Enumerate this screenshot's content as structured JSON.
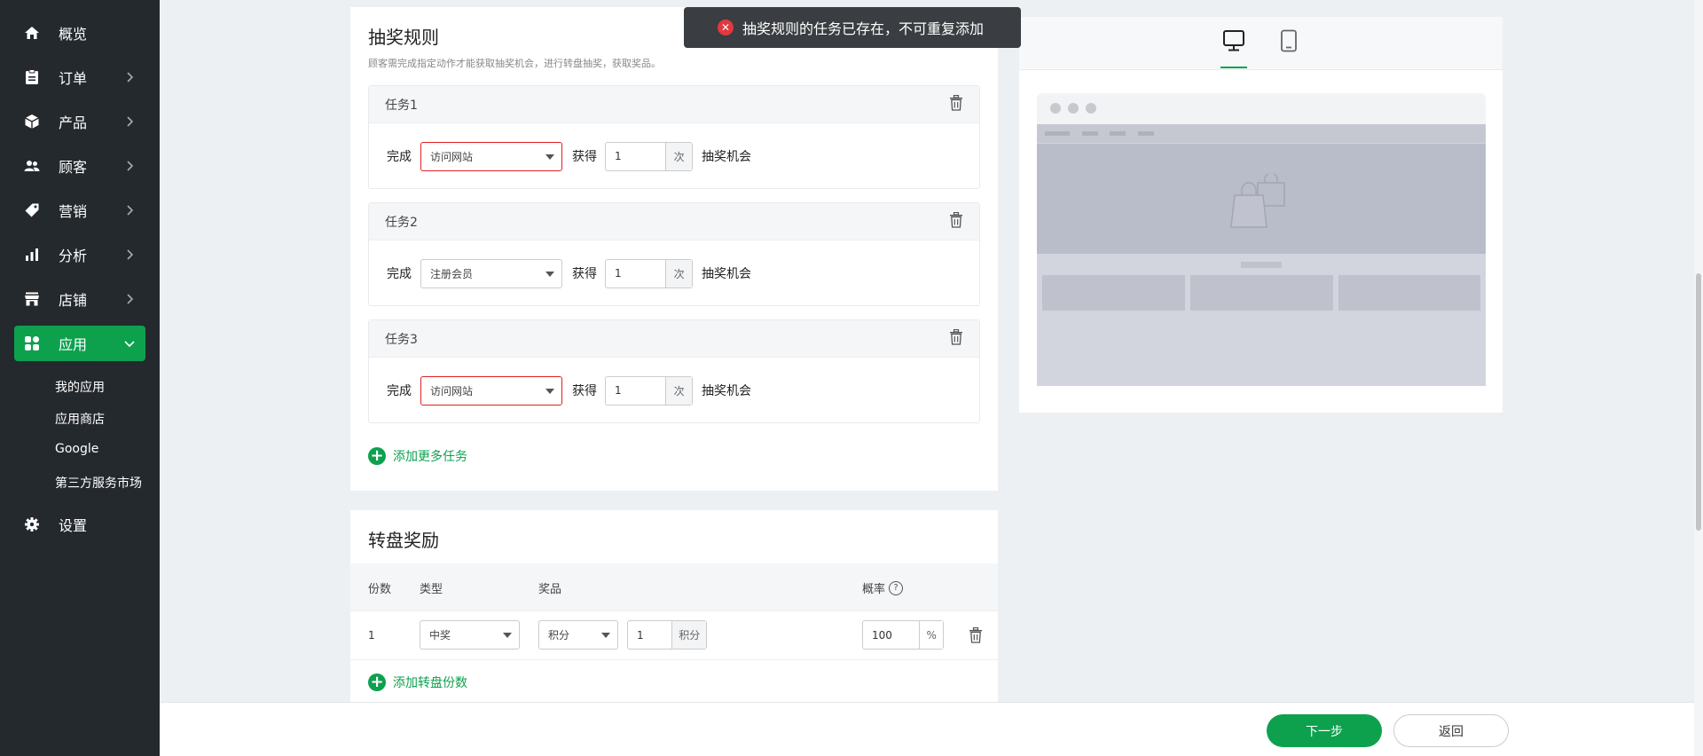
{
  "sidebar": {
    "items": [
      {
        "label": "概览",
        "icon": "home-icon",
        "chevron": false
      },
      {
        "label": "订单",
        "icon": "clipboard-icon",
        "chevron": true
      },
      {
        "label": "产品",
        "icon": "box-icon",
        "chevron": true
      },
      {
        "label": "顾客",
        "icon": "people-icon",
        "chevron": true
      },
      {
        "label": "营销",
        "icon": "tag-icon",
        "chevron": true
      },
      {
        "label": "分析",
        "icon": "bar-chart-icon",
        "chevron": true
      },
      {
        "label": "店铺",
        "icon": "store-icon",
        "chevron": true
      },
      {
        "label": "应用",
        "icon": "apps-icon",
        "chevron": true,
        "active": true
      },
      {
        "label": "设置",
        "icon": "gear-icon",
        "chevron": false
      }
    ],
    "sub_items": [
      "我的应用",
      "应用商店",
      "Google",
      "第三方服务市场"
    ]
  },
  "toast": {
    "message": "抽奖规则的任务已存在，不可重复添加",
    "color": "#e0393e"
  },
  "rules": {
    "title": "抽奖规则",
    "desc": "顾客需完成指定动作才能获取抽奖机会，进行转盘抽奖，获取奖品。",
    "tasks": [
      {
        "name": "任务1",
        "complete_label": "完成",
        "action": "访问网站",
        "error": true,
        "get_label": "获得",
        "count": "1",
        "count_unit": "次",
        "reward_label": "抽奖机会"
      },
      {
        "name": "任务2",
        "complete_label": "完成",
        "action": "注册会员",
        "error": false,
        "get_label": "获得",
        "count": "1",
        "count_unit": "次",
        "reward_label": "抽奖机会"
      },
      {
        "name": "任务3",
        "complete_label": "完成",
        "action": "访问网站",
        "error": true,
        "get_label": "获得",
        "count": "1",
        "count_unit": "次",
        "reward_label": "抽奖机会"
      }
    ],
    "add_task_label": "添加更多任务"
  },
  "rewards": {
    "title": "转盘奖励",
    "columns": {
      "count": "份数",
      "type": "类型",
      "prize": "奖品",
      "probability": "概率"
    },
    "rows": [
      {
        "count": "1",
        "type": "中奖",
        "prize_type": "积分",
        "prize_amount": "1",
        "prize_unit": "积分",
        "probability": "100",
        "probability_unit": "%"
      }
    ],
    "add_label": "添加转盘份数"
  },
  "preview": {
    "tabs": [
      "desktop-icon",
      "mobile-icon"
    ],
    "active_tab": 0
  },
  "footer": {
    "next_label": "下一步",
    "back_label": "返回"
  },
  "colors": {
    "accent": "#0da14e",
    "sidebar": "#24292e",
    "error": "#e02020"
  }
}
